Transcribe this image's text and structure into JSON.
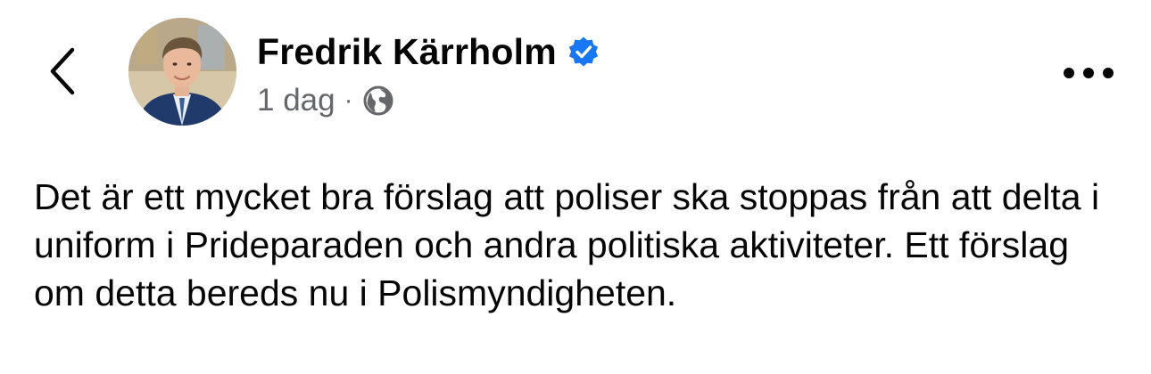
{
  "post": {
    "author": "Fredrik Kärrholm",
    "verified": true,
    "timestamp": "1 dag",
    "separator": "·",
    "audience_icon": "globe-icon",
    "body": "Det är ett mycket bra förslag att poliser ska stoppas från att delta i uniform i Prideparaden och andra politiska aktiviteter. Ett förslag om detta bereds nu i Polismyndigheten."
  },
  "icons": {
    "back": "chevron-left-icon",
    "more": "ellipsis-icon",
    "verified": "verified-badge-icon"
  },
  "colors": {
    "text": "#050505",
    "secondary_text": "#65676b",
    "verified_blue": "#1877f2",
    "background": "#ffffff"
  }
}
